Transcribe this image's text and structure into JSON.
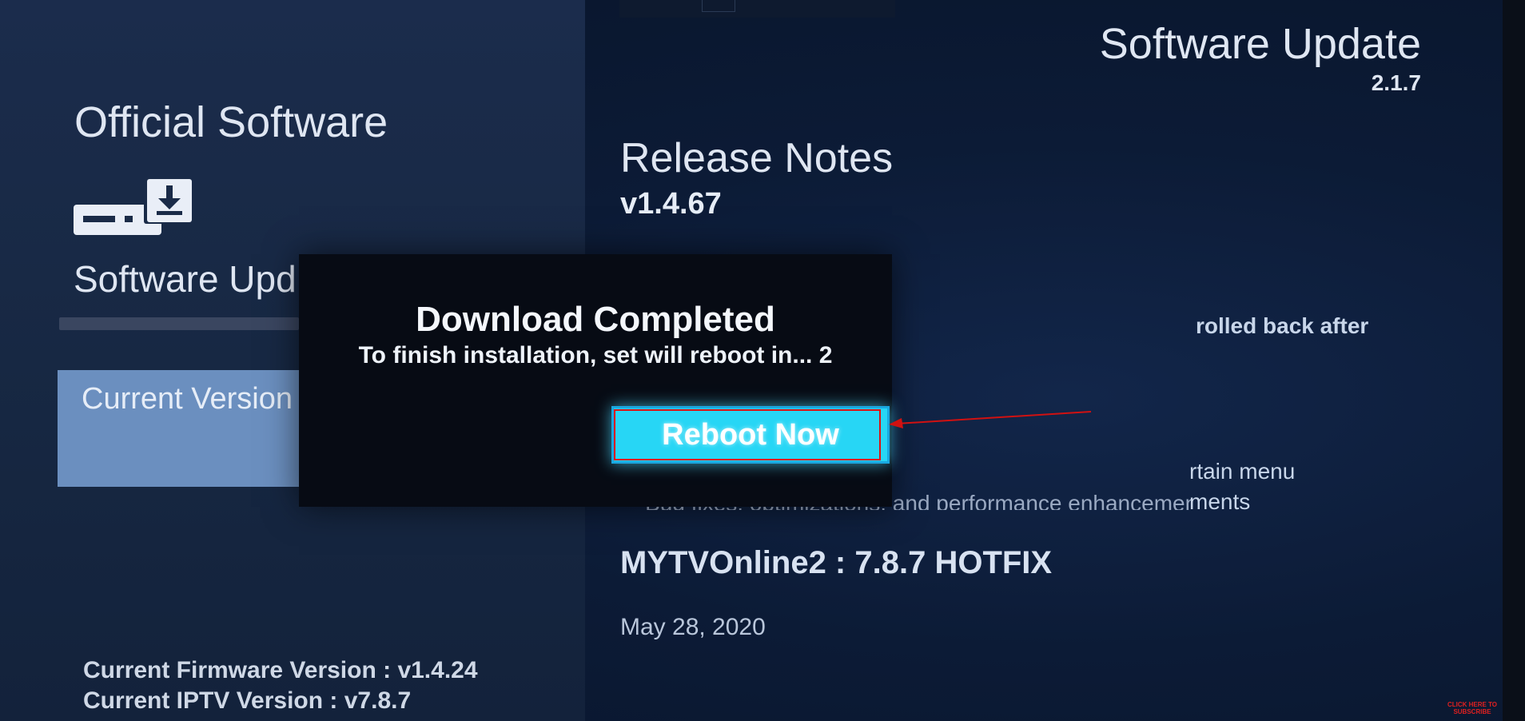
{
  "left_panel": {
    "heading": "Official Software",
    "menu_item": "Software Upd",
    "selected_item": "Current Version",
    "firmware_version": "Current Firmware Version : v1.4.24",
    "iptv_version": "Current IPTV Version : v7.8.7"
  },
  "header": {
    "title": "Software Update",
    "version": "2.1.7"
  },
  "release_notes": {
    "title": "Release Notes",
    "version": "v1.4.67",
    "note_fragment_1": "rolled back after",
    "note_fragment_2": "rtain menu",
    "note_fragment_3": "ments",
    "note_bug_line": "- Bug fixes, optimizations, and performance enhancements",
    "app_title": "MYTVOnline2 : 7.8.7 HOTFIX",
    "app_date": "May 28, 2020"
  },
  "dialog": {
    "title": "Download Completed",
    "message": "To finish installation, set will reboot in... 2",
    "button_label": "Reboot Now"
  },
  "overlay": {
    "subscribe_line1": "CLICK HERE TO",
    "subscribe_line2": "SUBSCRIBE"
  },
  "icons": {
    "device": "set-top-box-download-icon",
    "arrow": "red-annotation-arrow"
  },
  "colors": {
    "accent_button": "#27d6f5",
    "selected_bg": "#6b8fbf",
    "annotation": "#d11111"
  }
}
